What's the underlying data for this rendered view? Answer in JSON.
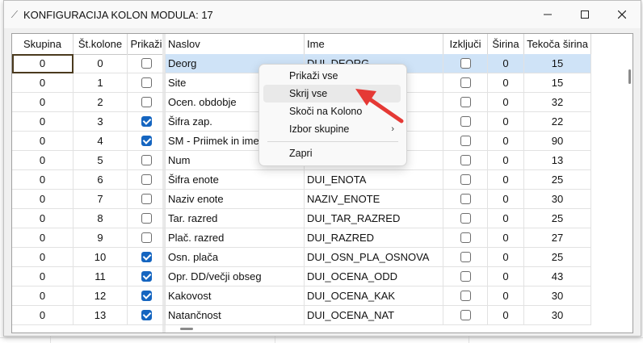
{
  "window": {
    "title": "KONFIGURACIJA KOLON MODULA: 17",
    "minimize_icon": "minimize-icon",
    "maximize_icon": "maximize-icon",
    "close_icon": "close-icon"
  },
  "columns": {
    "skupina": "Skupina",
    "st_kolone": "Št.kolone",
    "prikazi": "Prikaži",
    "naslov": "Naslov",
    "ime": "Ime",
    "izkljuci": "Izključi",
    "sirina": "Širina",
    "tekoca_sirina": "Tekoča širina"
  },
  "rows": [
    {
      "skupina": "0",
      "st": "0",
      "prikazi": false,
      "naslov": "Deorg",
      "ime": "DUI_DEORG",
      "izkljuci": false,
      "sirina": "0",
      "tekoca": "15"
    },
    {
      "skupina": "0",
      "st": "1",
      "prikazi": false,
      "naslov": "Site",
      "ime": "",
      "izkljuci": false,
      "sirina": "0",
      "tekoca": "15"
    },
    {
      "skupina": "0",
      "st": "2",
      "prikazi": false,
      "naslov": "Ocen. obdobje",
      "ime": "",
      "izkljuci": false,
      "sirina": "0",
      "tekoca": "32"
    },
    {
      "skupina": "0",
      "st": "3",
      "prikazi": true,
      "naslov": "Šifra zap.",
      "ime": "",
      "izkljuci": false,
      "sirina": "0",
      "tekoca": "22"
    },
    {
      "skupina": "0",
      "st": "4",
      "prikazi": true,
      "naslov": "SM - Priimek in ime",
      "ime": "",
      "izkljuci": false,
      "sirina": "0",
      "tekoca": "90"
    },
    {
      "skupina": "0",
      "st": "5",
      "prikazi": false,
      "naslov": "Num",
      "ime": "",
      "izkljuci": false,
      "sirina": "0",
      "tekoca": "13"
    },
    {
      "skupina": "0",
      "st": "6",
      "prikazi": false,
      "naslov": "Šifra enote",
      "ime": "DUI_ENOTA",
      "izkljuci": false,
      "sirina": "0",
      "tekoca": "25"
    },
    {
      "skupina": "0",
      "st": "7",
      "prikazi": false,
      "naslov": "Naziv enote",
      "ime": "NAZIV_ENOTE",
      "izkljuci": false,
      "sirina": "0",
      "tekoca": "30"
    },
    {
      "skupina": "0",
      "st": "8",
      "prikazi": false,
      "naslov": "Tar. razred",
      "ime": "DUI_TAR_RAZRED",
      "izkljuci": false,
      "sirina": "0",
      "tekoca": "25"
    },
    {
      "skupina": "0",
      "st": "9",
      "prikazi": false,
      "naslov": "Plač. razred",
      "ime": "DUI_RAZRED",
      "izkljuci": false,
      "sirina": "0",
      "tekoca": "27"
    },
    {
      "skupina": "0",
      "st": "10",
      "prikazi": true,
      "naslov": "Osn. plača",
      "ime": "DUI_OSN_PLA_OSNOVA",
      "izkljuci": false,
      "sirina": "0",
      "tekoca": "25"
    },
    {
      "skupina": "0",
      "st": "11",
      "prikazi": true,
      "naslov": "Opr. DD/večji obseg",
      "ime": "DUI_OCENA_ODD",
      "izkljuci": false,
      "sirina": "0",
      "tekoca": "43"
    },
    {
      "skupina": "0",
      "st": "12",
      "prikazi": true,
      "naslov": "Kakovost",
      "ime": "DUI_OCENA_KAK",
      "izkljuci": false,
      "sirina": "0",
      "tekoca": "30"
    },
    {
      "skupina": "0",
      "st": "13",
      "prikazi": true,
      "naslov": "Natančnost",
      "ime": "DUI_OCENA_NAT",
      "izkljuci": false,
      "sirina": "0",
      "tekoca": "30"
    }
  ],
  "context_menu": {
    "items": [
      "Prikaži vse",
      "Skrij vse",
      "Skoči na Kolono",
      "Izbor skupine",
      "Zapri"
    ],
    "hovered": "Skrij vse",
    "submenu_icon": "chevron-right-icon"
  },
  "colors": {
    "selection": "#cfe3f7",
    "checkbox_checked": "#1565c0",
    "annotation_arrow": "#e53935"
  }
}
